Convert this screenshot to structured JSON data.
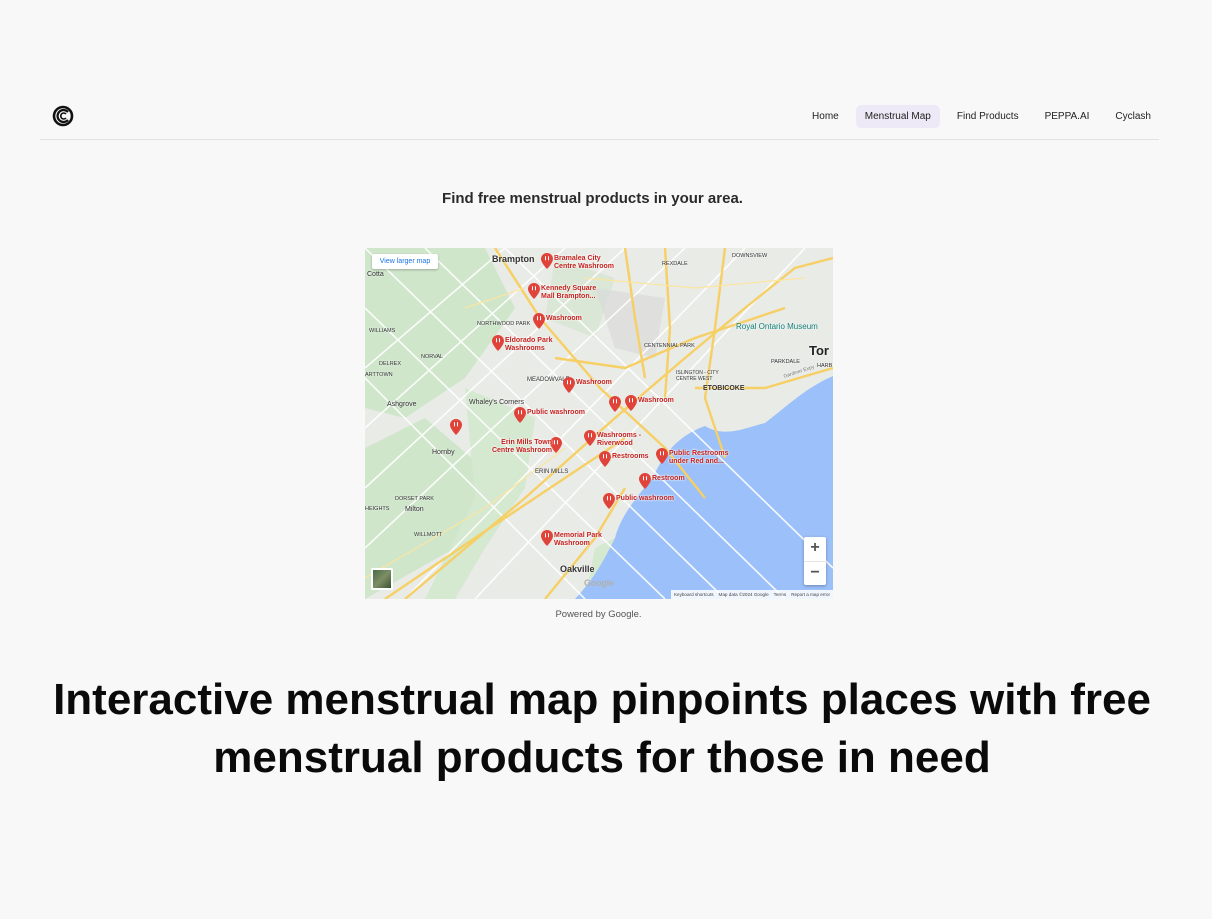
{
  "nav": {
    "items": [
      "Home",
      "Menstrual Map",
      "Find Products",
      "PEPPA.AI",
      "Cyclash"
    ],
    "active": "Menstrual Map"
  },
  "subtitle": "Find free menstrual products in your area.",
  "map": {
    "view_larger": "View larger map",
    "zoom_in": "+",
    "zoom_out": "−",
    "logo_text": "Google",
    "attribution": [
      "Keyboard shortcuts",
      "Map data ©2024 Google",
      "Terms",
      "Report a map error"
    ],
    "markers": [
      {
        "label": "Bramalea City Centre Washroom"
      },
      {
        "label": "Kennedy Square Mall Brampton..."
      },
      {
        "label": "Washroom"
      },
      {
        "label": "Eldorado Park Washrooms"
      },
      {
        "label": "Washroom"
      },
      {
        "label": "Washroom"
      },
      {
        "label": "Public washroom"
      },
      {
        "label": "Erin Mills Town Centre Washroom"
      },
      {
        "label": "Washrooms - Riverwood"
      },
      {
        "label": "Restrooms"
      },
      {
        "label": "Public Restrooms under Red and..."
      },
      {
        "label": "Restroom"
      },
      {
        "label": "Public washroom"
      },
      {
        "label": "Memorial Park Washroom"
      },
      {
        "label": ""
      },
      {
        "label": ""
      }
    ],
    "places": [
      "Brampton",
      "Oakville",
      "Milton",
      "Ashgrove",
      "Hornby",
      "Whaley's Corners",
      "ETOBICOKE",
      "Royal Ontario Museum",
      "Tor",
      "ERIN MILLS",
      "MEADOWVALE",
      "NORTHWOOD PARK",
      "WILLIAMS",
      "CENTENNIAL PARK",
      "DOWNSVIEW",
      "REXDALE",
      "PARKDALE",
      "DORSET PARK",
      "WILLMOTT",
      "Cotta",
      "NORVAL",
      "DELREX",
      "ARTTOWN",
      "HEIGHTS",
      "ISLINGTON - CITY CENTRE WEST",
      "HARB",
      "Gardiner Expy"
    ]
  },
  "powered": "Powered by Google.",
  "headline": "Interactive menstrual map pinpoints places with free menstrual products for those in need"
}
